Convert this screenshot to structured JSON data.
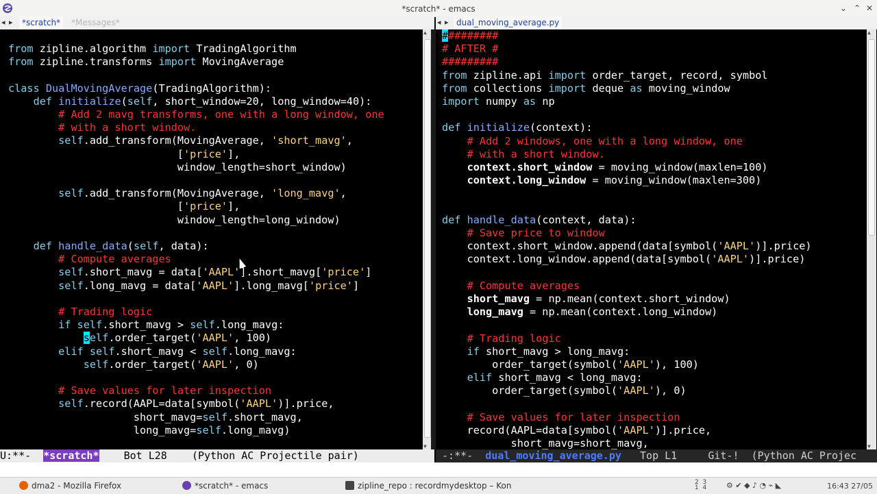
{
  "window": {
    "title": "*scratch* - emacs",
    "buttons": [
      "⌄",
      "⌃",
      "✕"
    ]
  },
  "left_tabs": [
    {
      "label": "*scratch*",
      "active": true
    },
    {
      "label": "*Messages*",
      "active": false
    }
  ],
  "right_tabs": [
    {
      "label": "dual_moving_average.py",
      "active": true
    }
  ],
  "tab_arrows": "◂ ▸",
  "left_code": [
    [
      {
        "t": "from",
        "c": "kw"
      },
      {
        "t": " zipline.algorithm "
      },
      {
        "t": "import",
        "c": "kw"
      },
      {
        "t": " TradingAlgorithm"
      }
    ],
    [
      {
        "t": "from",
        "c": "kw"
      },
      {
        "t": " zipline.transforms "
      },
      {
        "t": "import",
        "c": "kw"
      },
      {
        "t": " MovingAverage"
      }
    ],
    [],
    [
      {
        "t": "class",
        "c": "kw"
      },
      {
        "t": " "
      },
      {
        "t": "DualMovingAverage",
        "c": "fn"
      },
      {
        "t": "(TradingAlgorithm):"
      }
    ],
    [
      {
        "t": "    "
      },
      {
        "t": "def",
        "c": "kw"
      },
      {
        "t": " "
      },
      {
        "t": "initialize",
        "c": "fn"
      },
      {
        "t": "("
      },
      {
        "t": "self",
        "c": "kw"
      },
      {
        "t": ", short_window=20, long_window=40):"
      }
    ],
    [
      {
        "t": "        "
      },
      {
        "t": "# Add 2 mavg transforms, one with a long window, one",
        "c": "cm"
      }
    ],
    [
      {
        "t": "        "
      },
      {
        "t": "# with a short window.",
        "c": "cm"
      }
    ],
    [
      {
        "t": "        "
      },
      {
        "t": "self",
        "c": "kw"
      },
      {
        "t": ".add_transform(MovingAverage, "
      },
      {
        "t": "'short_mavg'",
        "c": "str"
      },
      {
        "t": ","
      }
    ],
    [
      {
        "t": "                           ["
      },
      {
        "t": "'price'",
        "c": "str"
      },
      {
        "t": "],"
      }
    ],
    [
      {
        "t": "                           window_length=short_window)"
      }
    ],
    [],
    [
      {
        "t": "        "
      },
      {
        "t": "self",
        "c": "kw"
      },
      {
        "t": ".add_transform(MovingAverage, "
      },
      {
        "t": "'long_mavg'",
        "c": "str"
      },
      {
        "t": ","
      }
    ],
    [
      {
        "t": "                           ["
      },
      {
        "t": "'price'",
        "c": "str"
      },
      {
        "t": "],"
      }
    ],
    [
      {
        "t": "                           window_length=long_window)"
      }
    ],
    [],
    [
      {
        "t": "    "
      },
      {
        "t": "def",
        "c": "kw"
      },
      {
        "t": " "
      },
      {
        "t": "handle_data",
        "c": "fn"
      },
      {
        "t": "("
      },
      {
        "t": "self",
        "c": "kw"
      },
      {
        "t": ", data):"
      }
    ],
    [
      {
        "t": "        "
      },
      {
        "t": "# Compute averages",
        "c": "cm"
      }
    ],
    [
      {
        "t": "        "
      },
      {
        "t": "self",
        "c": "kw"
      },
      {
        "t": ".short_mavg = data["
      },
      {
        "t": "'AAPL'",
        "c": "str"
      },
      {
        "t": "].short_mavg["
      },
      {
        "t": "'price'",
        "c": "str"
      },
      {
        "t": "]"
      }
    ],
    [
      {
        "t": "        "
      },
      {
        "t": "self",
        "c": "kw"
      },
      {
        "t": ".long_mavg = data["
      },
      {
        "t": "'AAPL'",
        "c": "str"
      },
      {
        "t": "].long_mavg["
      },
      {
        "t": "'price'",
        "c": "str"
      },
      {
        "t": "]"
      }
    ],
    [],
    [
      {
        "t": "        "
      },
      {
        "t": "# Trading logic",
        "c": "cm"
      }
    ],
    [
      {
        "t": "        "
      },
      {
        "t": "if",
        "c": "kw"
      },
      {
        "t": " "
      },
      {
        "t": "self",
        "c": "kw"
      },
      {
        "t": ".short_mavg > "
      },
      {
        "t": "self",
        "c": "kw"
      },
      {
        "t": ".long_mavg:"
      }
    ],
    [
      {
        "t": "            "
      },
      {
        "t": "s",
        "c": "cur"
      },
      {
        "t": "elf",
        "c": "kw"
      },
      {
        "t": ".order_target("
      },
      {
        "t": "'AAPL'",
        "c": "str"
      },
      {
        "t": ", 100)"
      }
    ],
    [
      {
        "t": "        "
      },
      {
        "t": "elif",
        "c": "kw"
      },
      {
        "t": " "
      },
      {
        "t": "self",
        "c": "kw"
      },
      {
        "t": ".short_mavg < "
      },
      {
        "t": "self",
        "c": "kw"
      },
      {
        "t": ".long_mavg:"
      }
    ],
    [
      {
        "t": "            "
      },
      {
        "t": "self",
        "c": "kw"
      },
      {
        "t": ".order_target("
      },
      {
        "t": "'AAPL'",
        "c": "str"
      },
      {
        "t": ", 0)"
      }
    ],
    [],
    [
      {
        "t": "        "
      },
      {
        "t": "# Save values for later inspection",
        "c": "cm"
      }
    ],
    [
      {
        "t": "        "
      },
      {
        "t": "self",
        "c": "kw"
      },
      {
        "t": ".record(AAPL=data[symbol("
      },
      {
        "t": "'AAPL'",
        "c": "str"
      },
      {
        "t": ")].price,"
      }
    ],
    [
      {
        "t": "                    short_mavg="
      },
      {
        "t": "self",
        "c": "kw"
      },
      {
        "t": ".short_mavg,"
      }
    ],
    [
      {
        "t": "                    long_mavg="
      },
      {
        "t": "self",
        "c": "kw"
      },
      {
        "t": ".long_mavg)"
      }
    ]
  ],
  "right_code": [
    [
      {
        "t": "#",
        "c": "cur"
      },
      {
        "t": "########",
        "c": "cm"
      }
    ],
    [
      {
        "t": "# AFTER #",
        "c": "cm"
      }
    ],
    [
      {
        "t": "#########",
        "c": "cm"
      }
    ],
    [
      {
        "t": "from",
        "c": "kw"
      },
      {
        "t": " zipline.api "
      },
      {
        "t": "import",
        "c": "kw"
      },
      {
        "t": " order_target, record, symbol"
      }
    ],
    [
      {
        "t": "from",
        "c": "kw"
      },
      {
        "t": " collections "
      },
      {
        "t": "import",
        "c": "kw"
      },
      {
        "t": " deque "
      },
      {
        "t": "as",
        "c": "kw"
      },
      {
        "t": " moving_window"
      }
    ],
    [
      {
        "t": "import",
        "c": "kw"
      },
      {
        "t": " numpy "
      },
      {
        "t": "as",
        "c": "kw"
      },
      {
        "t": " np"
      }
    ],
    [],
    [
      {
        "t": "def",
        "c": "kw"
      },
      {
        "t": " "
      },
      {
        "t": "initialize",
        "c": "fn"
      },
      {
        "t": "(context):"
      }
    ],
    [
      {
        "t": "    "
      },
      {
        "t": "# Add 2 windows, one with a long window, one",
        "c": "cm"
      }
    ],
    [
      {
        "t": "    "
      },
      {
        "t": "# with a short window.",
        "c": "cm"
      }
    ],
    [
      {
        "t": "    "
      },
      {
        "t": "context.short_window",
        "c": "bold"
      },
      {
        "t": " = moving_window(maxlen=100)"
      }
    ],
    [
      {
        "t": "    "
      },
      {
        "t": "context.long_window",
        "c": "bold"
      },
      {
        "t": " = moving_window(maxlen=300)"
      }
    ],
    [],
    [],
    [
      {
        "t": "def",
        "c": "kw"
      },
      {
        "t": " "
      },
      {
        "t": "handle_data",
        "c": "fn"
      },
      {
        "t": "(context, data):"
      }
    ],
    [
      {
        "t": "    "
      },
      {
        "t": "# Save price to window",
        "c": "cm"
      }
    ],
    [
      {
        "t": "    context.short_window.append(data[symbol("
      },
      {
        "t": "'AAPL'",
        "c": "str"
      },
      {
        "t": ")].price)"
      }
    ],
    [
      {
        "t": "    context.long_window.append(data[symbol("
      },
      {
        "t": "'AAPL'",
        "c": "str"
      },
      {
        "t": ")].price)"
      }
    ],
    [],
    [
      {
        "t": "    "
      },
      {
        "t": "# Compute averages",
        "c": "cm"
      }
    ],
    [
      {
        "t": "    "
      },
      {
        "t": "short_mavg",
        "c": "bold"
      },
      {
        "t": " = np.mean(context.short_window)"
      }
    ],
    [
      {
        "t": "    "
      },
      {
        "t": "long_mavg",
        "c": "bold"
      },
      {
        "t": " = np.mean(context.long_window)"
      }
    ],
    [],
    [
      {
        "t": "    "
      },
      {
        "t": "# Trading logic",
        "c": "cm"
      }
    ],
    [
      {
        "t": "    "
      },
      {
        "t": "if",
        "c": "kw"
      },
      {
        "t": " short_mavg > long_mavg:"
      }
    ],
    [
      {
        "t": "        order_target(symbol("
      },
      {
        "t": "'AAPL'",
        "c": "str"
      },
      {
        "t": "), 100)"
      }
    ],
    [
      {
        "t": "    "
      },
      {
        "t": "elif",
        "c": "kw"
      },
      {
        "t": " short_mavg < long_mavg:"
      }
    ],
    [
      {
        "t": "        order_target(symbol("
      },
      {
        "t": "'AAPL'",
        "c": "str"
      },
      {
        "t": "), 0)"
      }
    ],
    [],
    [
      {
        "t": "    "
      },
      {
        "t": "# Save values for later inspection",
        "c": "cm"
      }
    ],
    [
      {
        "t": "    record(AAPL=data[symbol("
      },
      {
        "t": "'AAPL'",
        "c": "str"
      },
      {
        "t": ")].price,"
      }
    ],
    [
      {
        "t": "           short_mavg=short_mavg,"
      }
    ]
  ],
  "modeline_left": {
    "status": "U:**-  ",
    "buffer": "*scratch*",
    "rest": "    Bot L28    (Python AC Projectile pair)"
  },
  "modeline_right": {
    "status": " -:**-  ",
    "buffer": "dual_moving_average.py",
    "rest": "   Top L1     Git-!  (Python AC Projec"
  },
  "taskbar": {
    "tasks": [
      {
        "label": "dma2 - Mozilla Firefox",
        "color": "#e66000"
      },
      {
        "label": "*scratch* - emacs",
        "color": "#6a3fb0"
      },
      {
        "label": "zipline_repo : recordmydesktop – Kon",
        "color": "#444444"
      }
    ],
    "tray": "2  3\n1  4",
    "clock": "16:43 27/05"
  }
}
